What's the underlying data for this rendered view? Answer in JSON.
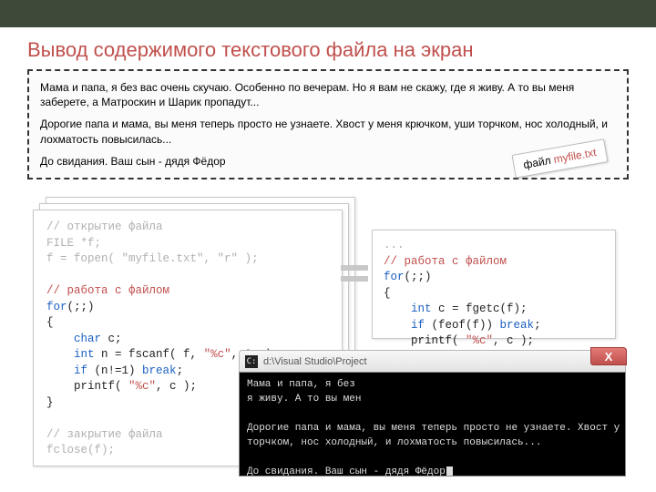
{
  "title": "Вывод содержимого текстового файла на экран",
  "letter": {
    "p1": "Мама и папа, я без вас очень скучаю. Особенно по вечерам. Но я вам не скажу, где я живу. А то вы меня заберете, а Матроскин и Шарик пропадут...",
    "p2": "Дорогие папа и мама, вы меня теперь просто не узнаете. Хвост у меня крючком, уши торчком, нос холодный, и лохматость повысилась...",
    "p3": "До свидания. Ваш сын - дядя Фёдор"
  },
  "file_badge": {
    "label": "файл ",
    "name": "myfile.txt"
  },
  "code_left": {
    "l1": "// открытие файла",
    "l2a": "FILE",
    "l2b": " *f;",
    "l3a": "f = fopen( ",
    "l3b": "\"myfile.txt\"",
    "l3c": ", ",
    "l3d": "\"r\"",
    "l3e": " );",
    "l4": "// работа с файлом",
    "l5a": "for",
    "l5b": "(;;)",
    "l6": "{",
    "l7a": "    ",
    "l7kw": "char",
    "l7b": " c;",
    "l8a": "    ",
    "l8kw": "int",
    "l8b": " n = fscanf( f, ",
    "l8str": "\"%c\"",
    "l8c": ", &c );",
    "l9a": "    ",
    "l9kw": "if",
    "l9b": " (n!=1) ",
    "l9kw2": "break",
    "l9c": ";",
    "l10a": "    printf( ",
    "l10str": "\"%c\"",
    "l10b": ", c );",
    "l11": "}",
    "l12": "// закрытие файла",
    "l13": "fclose(f);"
  },
  "code_right": {
    "d1": "...",
    "l1": "// работа с файлом",
    "l2a": "for",
    "l2b": "(;;)",
    "l3": "{",
    "l4a": "    ",
    "l4kw": "int",
    "l4b": " c = fgetc(f);",
    "l5a": "    ",
    "l5kw": "if",
    "l5b": " (feof(f)) ",
    "l5kw2": "break",
    "l5c": ";",
    "l6a": "    printf( ",
    "l6str": "\"%c\"",
    "l6b": ", c );",
    "l7": "}",
    "d2": "..."
  },
  "console": {
    "path": "d:\\Visual Studio\\Project",
    "l1": "Мама и папа, я без",
    "l2": "я живу. А то вы мен",
    "l3": "",
    "l4": "Дорогие папа и мама, вы меня теперь просто не узнаете. Хвост у меня кр",
    "l5": "торчком, нос холодный, и лохматость повысилась...",
    "l6": "",
    "l7": "До свидания. Ваш сын - дядя Фёдор"
  }
}
